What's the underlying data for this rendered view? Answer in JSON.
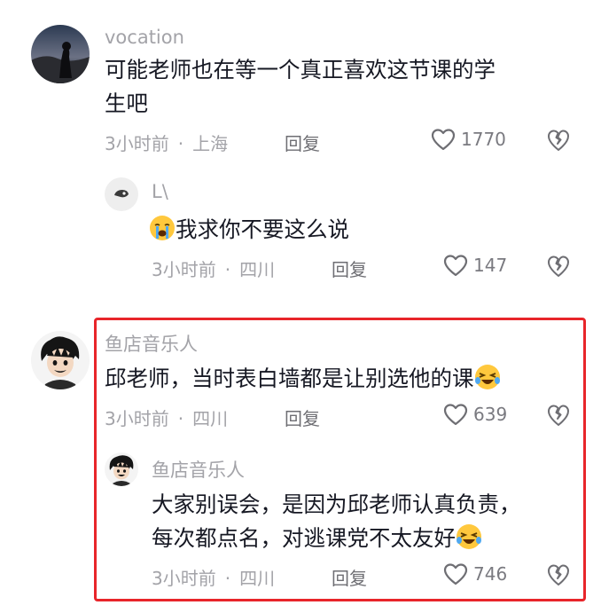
{
  "comments": [
    {
      "username": "vocation",
      "text_line1": "可能老师也在等一个真正喜欢这节课的学",
      "text_line2": "生吧",
      "time": "3小时前",
      "location": "上海",
      "reply_label": "回复",
      "likes": "1770"
    },
    {
      "username": "L\\",
      "text": "我求你不要这么说",
      "time": "3小时前",
      "location": "四川",
      "reply_label": "回复",
      "likes": "147"
    },
    {
      "username": "鱼店音乐人",
      "text": "邱老师，当时表白墙都是让别选他的课",
      "time": "3小时前",
      "location": "四川",
      "reply_label": "回复",
      "likes": "639"
    },
    {
      "username": "鱼店音乐人",
      "text_line1": "大家别误会，是因为邱老师认真负责，",
      "text_line2": "每次都点名，对逃课党不太友好",
      "time": "3小时前",
      "location": "四川",
      "reply_label": "回复",
      "likes": "746"
    }
  ],
  "separator": "·",
  "colors": {
    "highlight": "#e8252a"
  },
  "icons": [
    "heart-icon",
    "broken-heart-icon",
    "crying-emoji",
    "laughing-emoji"
  ]
}
